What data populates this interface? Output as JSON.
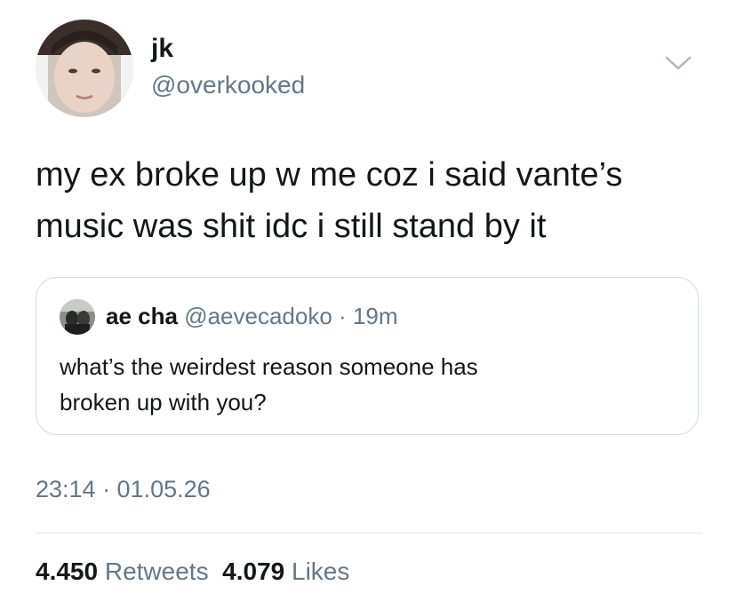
{
  "author": {
    "display_name": "jk",
    "handle": "@overkooked",
    "avatar": "profile-photo"
  },
  "menu_icon": "chevron-down-icon",
  "tweet": {
    "lines": [
      "my ex broke up w me coz i said vante’s",
      "music was shit idc i still stand by it"
    ]
  },
  "quoted_tweet": {
    "display_name": "ae cha",
    "handle": "@aevecadoko",
    "separator": "·",
    "time": "19m",
    "lines": [
      "what’s the weirdest reason someone has",
      "broken up with you?"
    ]
  },
  "timestamp": "23:14 · 01.05.26",
  "stats": {
    "retweets_count": "4.450",
    "retweets_label": "Retweets",
    "likes_count": "4.079",
    "likes_label": "Likes"
  },
  "colors": {
    "text_primary": "#14171a",
    "text_secondary": "#657786",
    "border": "#d4dce2"
  }
}
